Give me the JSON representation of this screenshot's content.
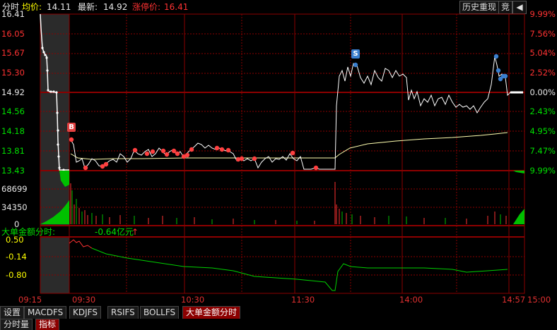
{
  "header": {
    "mode": "分时",
    "avg_label": "均价:",
    "avg_value": "14.11",
    "last_label": "最新:",
    "last_value": "14.92",
    "limit_label": "涨停价:",
    "limit_value": "16.41",
    "history_button": "历史重现",
    "bid_button": "竞",
    "back_icon": "back-arrow-icon"
  },
  "price_axis_left": [
    "16.41",
    "16.05",
    "15.67",
    "15.30",
    "14.92",
    "14.56",
    "14.18",
    "13.81",
    "13.43"
  ],
  "price_axis_right": [
    "9.99%",
    "7.56%",
    "5.04%",
    "2.52%",
    "0.00%",
    "2.43%",
    "4.95%",
    "7.47%",
    "9.99%"
  ],
  "volume_axis": [
    "68699",
    "34350",
    "0"
  ],
  "indicator": {
    "title": "大单金额分时:",
    "value": "-0.64亿元",
    "arrow": "↑",
    "axis": [
      "0.50",
      "-0.14",
      "-0.80"
    ]
  },
  "time_axis": [
    "09:15",
    "09:30",
    "10:30",
    "11:30",
    "14:00",
    "14:57",
    "15:00"
  ],
  "markers": {
    "buy": "B",
    "sell": "S"
  },
  "tabs": [
    "设置",
    "MACDFS",
    "KDJFS",
    "RSIFS",
    "BOLLFS",
    "大单金额分时"
  ],
  "bottom_tabs": [
    "分时量",
    "指标"
  ],
  "colors": {
    "grid": "#8c0000",
    "price": "#ffffff",
    "avg": "#ffffb0",
    "up": "#ff3232",
    "down": "#00d000",
    "indicator": "#00d000",
    "accent": "#ff3232"
  }
}
